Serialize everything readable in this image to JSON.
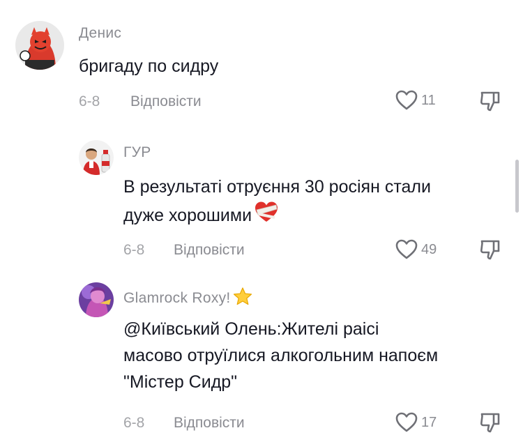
{
  "comments": [
    {
      "username": "Денис",
      "lines": [
        "бригаду по сидру"
      ],
      "date": "6-8",
      "reply_label": "Відповісти",
      "likes": "11",
      "avatar_icon": "red-devil-avatar"
    },
    {
      "username": "ГУР",
      "lines": [
        "В результаті отруєння 30 росіян стали",
        "дуже хорошими"
      ],
      "trailing_emoji": "heart-with-bandage-emoji",
      "date": "6-8",
      "reply_label": "Відповісти",
      "likes": "49",
      "avatar_icon": "man-with-bottle-avatar"
    },
    {
      "username": "Glamrock Roxy!",
      "username_emoji": "star-emoji",
      "lines": [
        "@Київський Олень:Жителі раісі",
        "масово отруїлися алкогольним напоєм",
        "\"Містер Сидр\""
      ],
      "date": "6-8",
      "reply_label": "Відповісти",
      "likes": "17",
      "avatar_icon": "purple-character-avatar"
    }
  ],
  "colors": {
    "text": "#161823",
    "meta": "#8a8b91",
    "accent_red": "#e0312b"
  }
}
